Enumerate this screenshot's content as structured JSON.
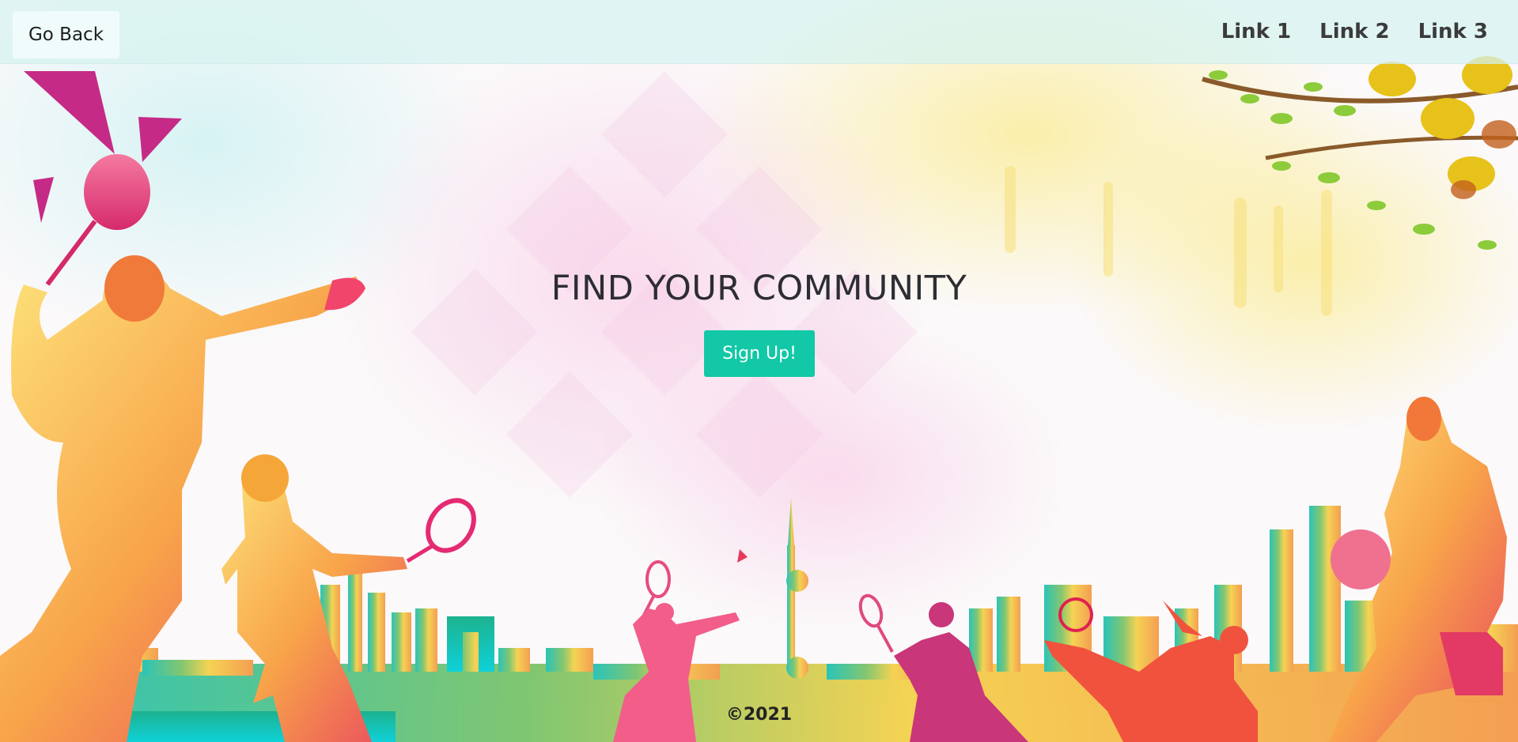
{
  "nav": {
    "back_label": "Go Back",
    "links": [
      "Link 1",
      "Link 2",
      "Link 3"
    ]
  },
  "hero": {
    "title": "FIND YOUR COMMUNITY",
    "signup_label": "Sign Up!"
  },
  "footer": {
    "copyright": "©2021"
  },
  "colors": {
    "accent": "#12c8a6",
    "navbar": "#d6f3f0",
    "title": "#2d2d33"
  },
  "icons": {
    "background": "sports-silhouette-city-skyline-illustration"
  }
}
